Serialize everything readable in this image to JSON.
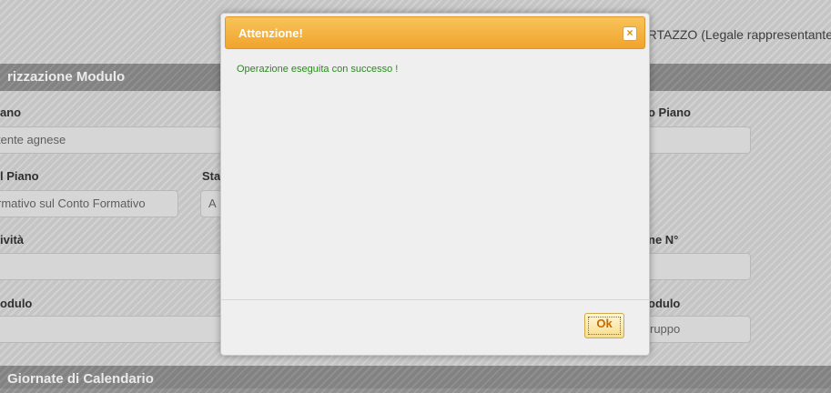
{
  "header": {
    "user_info": "CORTAZZO (Legale rappresentante"
  },
  "sections": {
    "module_title": "rizzazione Modulo",
    "calendar_title": "Giornate di Calendario"
  },
  "form": {
    "left": [
      {
        "label": "ano",
        "value": "tente agnese"
      },
      {
        "label": "l Piano",
        "value": "rmativo sul Conto Formativo"
      },
      {
        "label": "ività",
        "value": ""
      },
      {
        "label": "odulo",
        "value": ""
      }
    ],
    "middle": {
      "label": "Sta",
      "value": "A"
    },
    "right": [
      {
        "label": "o Piano",
        "value": ""
      },
      {
        "label": "ne N°",
        "value": ""
      },
      {
        "label": "odulo",
        "value": "ruppo"
      }
    ]
  },
  "dialog": {
    "title": "Attenzione!",
    "close_label": "×",
    "message": "Operazione eseguita con successo !",
    "ok_label": "Ok"
  }
}
